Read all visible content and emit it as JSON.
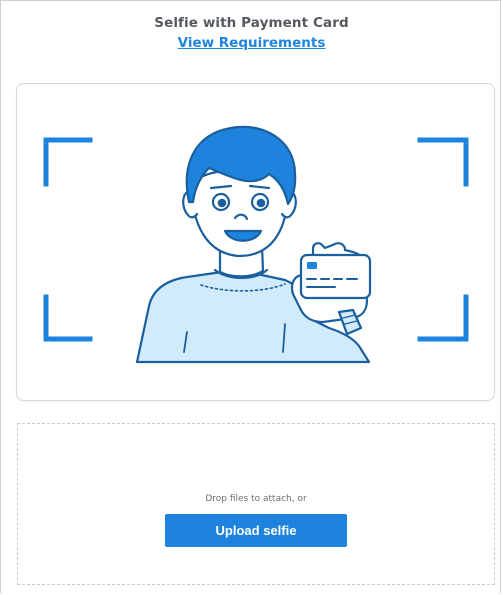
{
  "header": {
    "title": "Selfie with Payment Card",
    "link_label": "View Requirements"
  },
  "illustration": {
    "icon": "selfie-with-card-illustration",
    "accent_color": "#1e83dc",
    "fill_color": "#d2ebfb",
    "line_color": "#1a5f9e"
  },
  "dropzone": {
    "hint": "Drop files to attach, or",
    "upload_label": "Upload selfie"
  },
  "colors": {
    "primary": "#1e83dc",
    "title_text": "#555a60",
    "muted_text": "#6a6f74",
    "border": "#d4d7db"
  }
}
